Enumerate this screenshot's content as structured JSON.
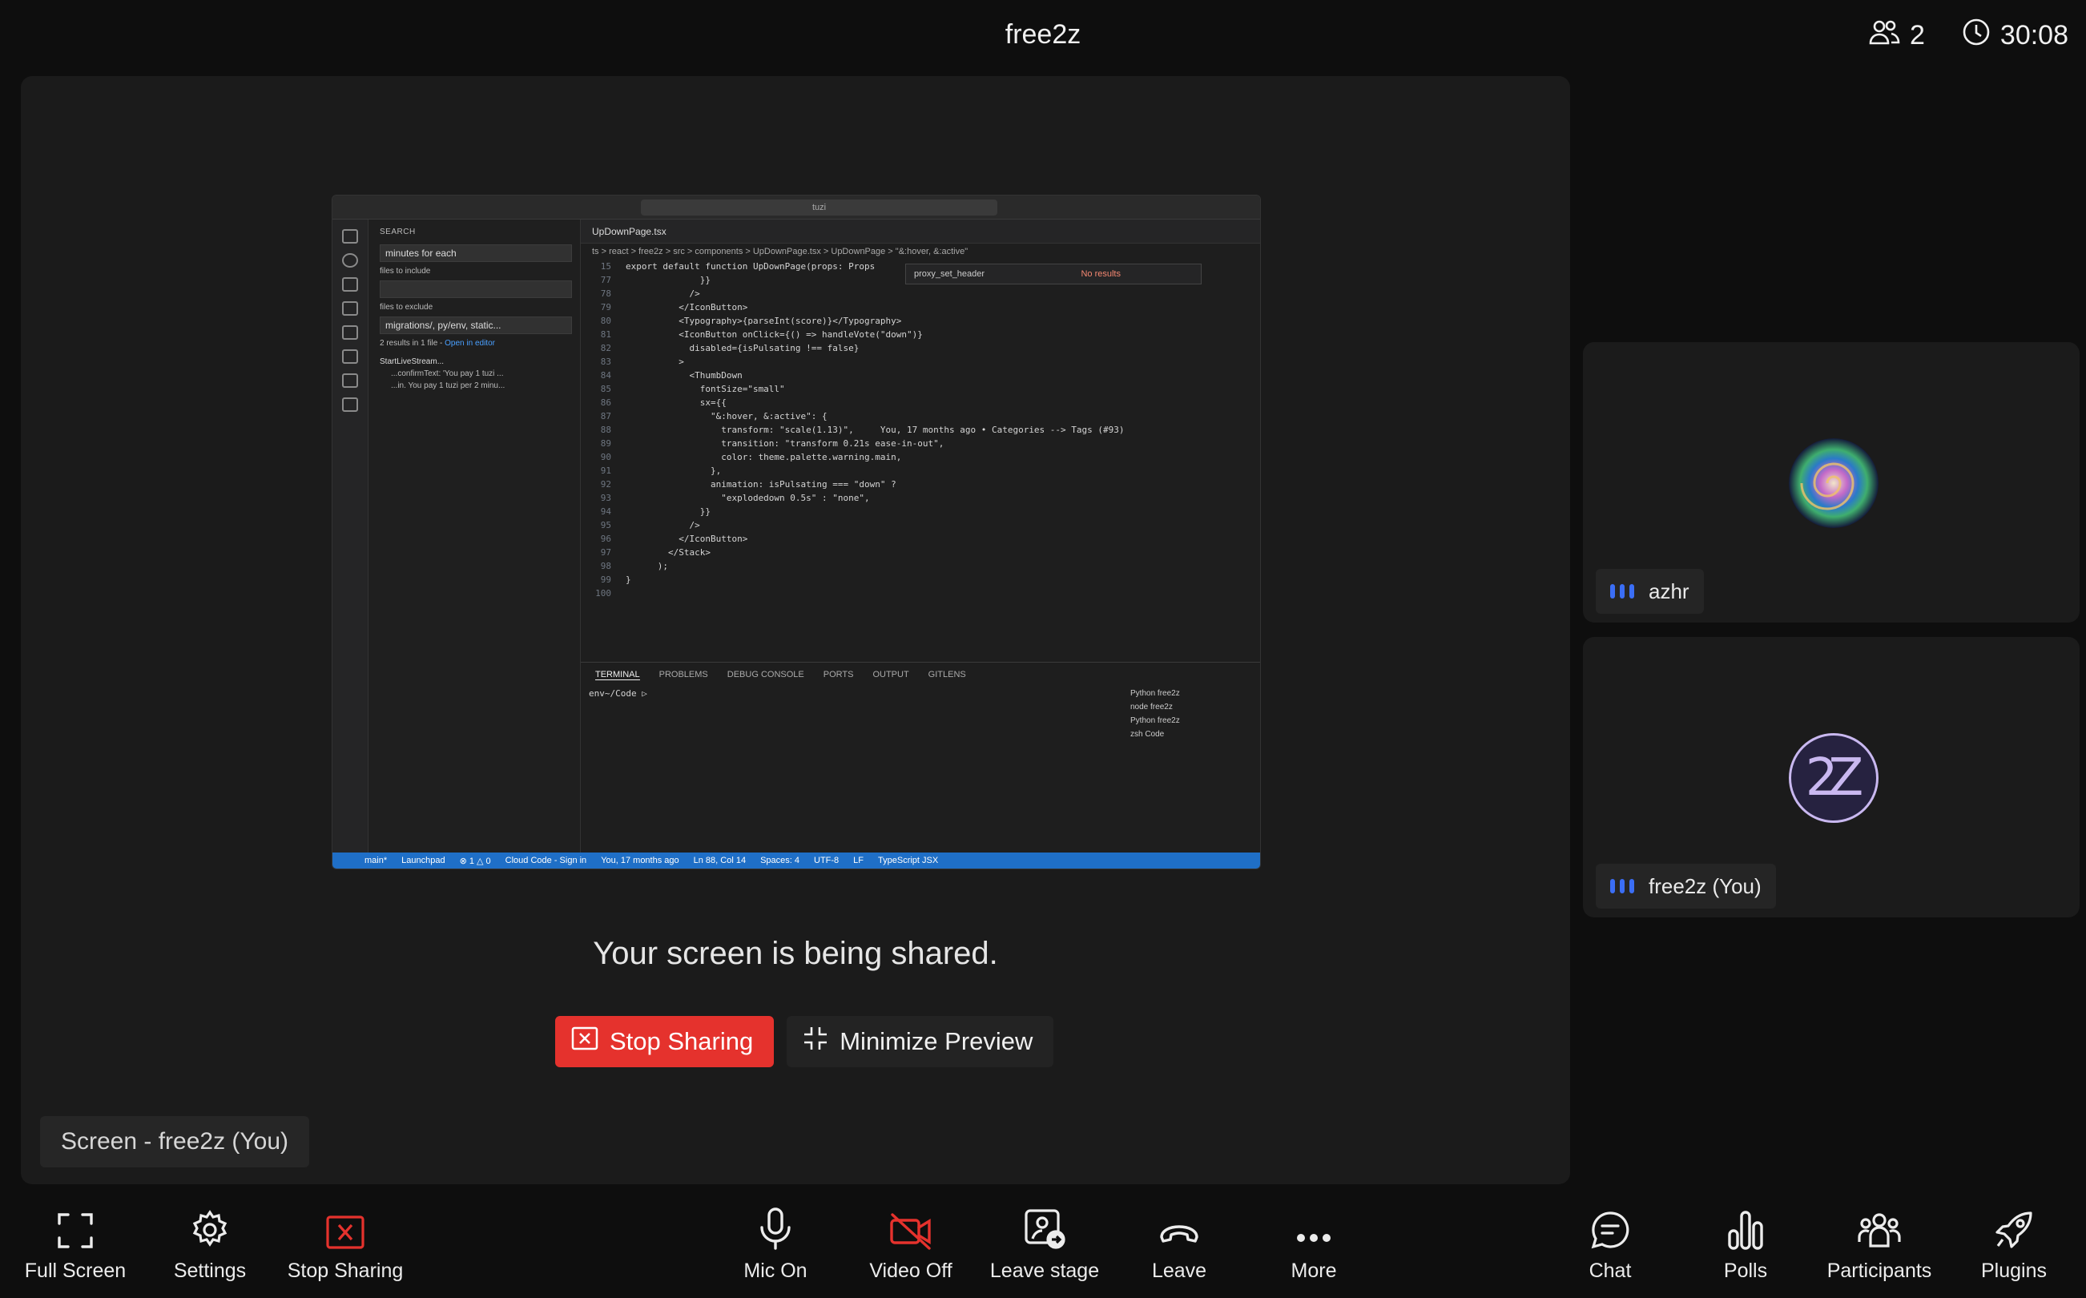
{
  "header": {
    "meeting_title": "free2z",
    "participant_count": "2",
    "timer": "30:08"
  },
  "stage": {
    "share_message": "Your screen is being shared.",
    "stop_sharing_label": "Stop Sharing",
    "minimize_preview_label": "Minimize Preview",
    "screen_label": "Screen - free2z (You)"
  },
  "participants": [
    {
      "name": "azhr"
    },
    {
      "name": "free2z (You)",
      "avatar_text": "2Z"
    }
  ],
  "toolbar": {
    "full_screen": "Full Screen",
    "settings": "Settings",
    "stop_sharing": "Stop Sharing",
    "mic_on": "Mic On",
    "video_off": "Video Off",
    "leave_stage": "Leave stage",
    "leave": "Leave",
    "more": "More",
    "chat": "Chat",
    "polls": "Polls",
    "participants": "Participants",
    "plugins": "Plugins"
  },
  "shared_screen": {
    "search_bar": "tuzi",
    "sidebar_header": "SEARCH",
    "search_query": "minutes for each",
    "files_to_include": "files to include",
    "files_to_exclude": "files to exclude",
    "exclude_value": "migrations/, py/env, static...",
    "results_summary": "2 results in 1 file - ",
    "open_in_editor": "Open in editor",
    "result_file": "StartLiveStream...",
    "result_line1": "...confirmText: 'You pay 1 tuzi ...",
    "result_line2": "...in. You pay 1 tuzi per 2 minu...",
    "tab": "UpDownPage.tsx",
    "breadcrumb": "ts > react > free2z > src > components > UpDownPage.tsx > UpDownPage > \"&:hover, &:active\"",
    "find_text": "proxy_set_header",
    "find_result": "No results",
    "code_lines": [
      {
        "n": "15",
        "t": "export default function UpDownPage(props: Props"
      },
      {
        "n": "77",
        "t": "              }}"
      },
      {
        "n": "78",
        "t": "            />"
      },
      {
        "n": "79",
        "t": "          </IconButton>"
      },
      {
        "n": "80",
        "t": "          <Typography>{parseInt(score)}</Typography>"
      },
      {
        "n": "81",
        "t": "          <IconButton onClick={() => handleVote(\"down\")}"
      },
      {
        "n": "82",
        "t": "            disabled={isPulsating !== false}"
      },
      {
        "n": "83",
        "t": "          >"
      },
      {
        "n": "84",
        "t": "            <ThumbDown"
      },
      {
        "n": "85",
        "t": "              fontSize=\"small\""
      },
      {
        "n": "86",
        "t": "              sx={{"
      },
      {
        "n": "87",
        "t": "                \"&:hover, &:active\": {"
      },
      {
        "n": "88",
        "t": "                  transform: \"scale(1.13)\",     You, 17 months ago • Categories --> Tags (#93)"
      },
      {
        "n": "89",
        "t": "                  transition: \"transform 0.21s ease-in-out\","
      },
      {
        "n": "90",
        "t": "                  color: theme.palette.warning.main,"
      },
      {
        "n": "91",
        "t": "                },"
      },
      {
        "n": "92",
        "t": "                animation: isPulsating === \"down\" ?"
      },
      {
        "n": "93",
        "t": "                  \"explodedown 0.5s\" : \"none\","
      },
      {
        "n": "94",
        "t": "              }}"
      },
      {
        "n": "95",
        "t": "            />"
      },
      {
        "n": "96",
        "t": "          </IconButton>"
      },
      {
        "n": "97",
        "t": "        </Stack>"
      },
      {
        "n": "98",
        "t": "      );"
      },
      {
        "n": "99",
        "t": "}"
      },
      {
        "n": "100",
        "t": ""
      }
    ],
    "panel_tabs": [
      "TERMINAL",
      "PROBLEMS",
      "DEBUG CONSOLE",
      "PORTS",
      "OUTPUT",
      "GITLENS"
    ],
    "terminal_prompt": "env~/Code ▷",
    "terminals": [
      "Python free2z",
      "node free2z",
      "Python free2z",
      "zsh Code"
    ],
    "status_items": [
      "main*",
      "Launchpad",
      "⊗ 1 △ 0",
      "Cloud Code - Sign in",
      "You, 17 months ago",
      "Ln 88, Col 14",
      "Spaces: 4",
      "UTF-8",
      "LF",
      "TypeScript JSX"
    ]
  },
  "colors": {
    "background": "#0e0e0e",
    "tile": "#1b1b1b",
    "danger": "#e5322d",
    "speaking": "#3b6ef5"
  }
}
